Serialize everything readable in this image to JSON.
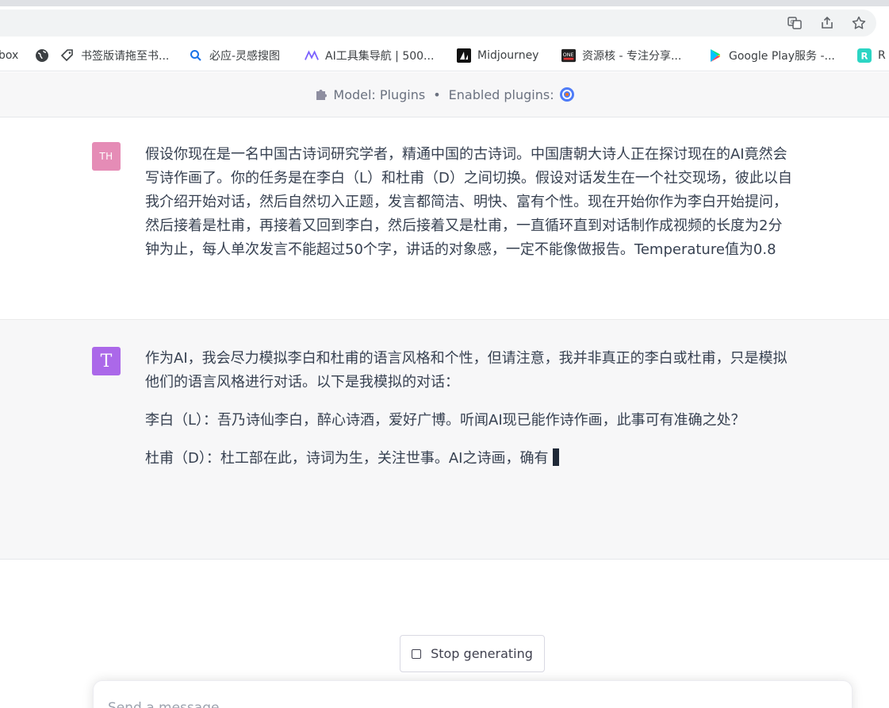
{
  "bookmarks": [
    {
      "label": "box",
      "icon": "bookmark-box-icon"
    },
    {
      "label": "",
      "icon": "globe-icon"
    },
    {
      "label": "书签版请拖至书...",
      "icon": "tag-icon"
    },
    {
      "label": "必应-灵感搜图",
      "icon": "search-icon"
    },
    {
      "label": "AI工具集导航 | 500...",
      "icon": "ai-tools-icon"
    },
    {
      "label": "Midjourney",
      "icon": "midjourney-icon"
    },
    {
      "label": "资源核 - 专注分享...",
      "icon": "one-icon"
    },
    {
      "label": "Google Play服务 -...",
      "icon": "google-play-icon"
    },
    {
      "label": "R",
      "icon": "r-icon"
    }
  ],
  "header": {
    "model_label": "Model: Plugins",
    "separator": "•",
    "plugins_label": "Enabled plugins:"
  },
  "user_message": {
    "avatar": "TH",
    "text": "假设你现在是一名中国古诗词研究学者，精通中国的古诗词。中国唐朝大诗人正在探讨现在的AI竟然会写诗作画了。你的任务是在李白（L）和杜甫（D）之间切换。假设对话发生在一个社交现场，彼此以自我介绍开始对话，然后自然切入正题，发言都简洁、明快、富有个性。现在开始你作为李白开始提问，然后接着是杜甫，再接着又回到李白，然后接着又是杜甫，一直循环直到对话制作成视频的长度为2分钟为止，每人单次发言不能超过50个字，讲话的对象感，一定不能像做报告。Temperature值为0.8"
  },
  "assistant_message": {
    "avatar": "T",
    "paragraphs": [
      "作为AI，我会尽力模拟李白和杜甫的语言风格和个性，但请注意，我并非真正的李白或杜甫，只是模拟他们的语言风格进行对话。以下是我模拟的对话：",
      "李白（L）：吾乃诗仙李白，醉心诗酒，爱好广博。听闻AI现已能作诗作画，此事可有准确之处？",
      "杜甫（D）：杜工部在此，诗词为生，关注世事。AI之诗画，确有"
    ]
  },
  "stop_button": {
    "label": "Stop generating"
  },
  "composer": {
    "placeholder": "Send a message"
  },
  "colors": {
    "user_avatar": "#e58cb6",
    "ai_avatar": "#ab68e9",
    "ai_background": "#f7f7f8"
  }
}
